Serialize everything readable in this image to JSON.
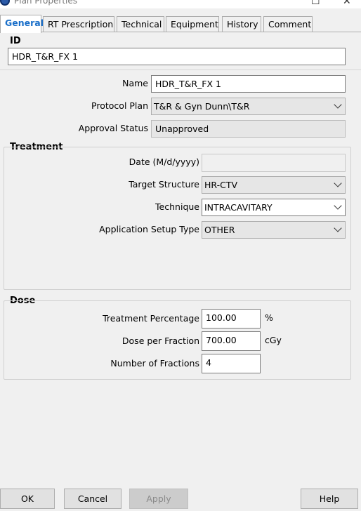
{
  "window": {
    "title": "Plan Properties"
  },
  "tabs": [
    {
      "label": "General"
    },
    {
      "label": "RT Prescription"
    },
    {
      "label": "Technical"
    },
    {
      "label": "Equipment"
    },
    {
      "label": "History"
    },
    {
      "label": "Comment"
    }
  ],
  "id_section": {
    "title": "ID",
    "value": "HDR_T&R_FX 1"
  },
  "general": {
    "name_label": "Name",
    "name_value": "HDR_T&R_FX 1",
    "protocol_label": "Protocol Plan",
    "protocol_value": "T&R & Gyn Dunn\\T&R",
    "approval_label": "Approval Status",
    "approval_value": "Unapproved"
  },
  "treatment": {
    "title": "Treatment",
    "date_label": "Date (M/d/yyyy)",
    "date_value": "",
    "target_label": "Target Structure",
    "target_value": "HR-CTV",
    "technique_label": "Technique",
    "technique_value": "INTRACAVITARY",
    "setup_label": "Application Setup Type",
    "setup_value": "OTHER"
  },
  "dose": {
    "title": "Dose",
    "pct_label": "Treatment Percentage",
    "pct_value": "100.00",
    "pct_unit": "%",
    "per_fraction_label": "Dose per Fraction",
    "per_fraction_value": "700.00",
    "per_fraction_unit": "cGy",
    "fractions_label": "Number of Fractions",
    "fractions_value": "4"
  },
  "buttons": {
    "ok": "OK",
    "cancel": "Cancel",
    "apply": "Apply",
    "help": "Help"
  }
}
